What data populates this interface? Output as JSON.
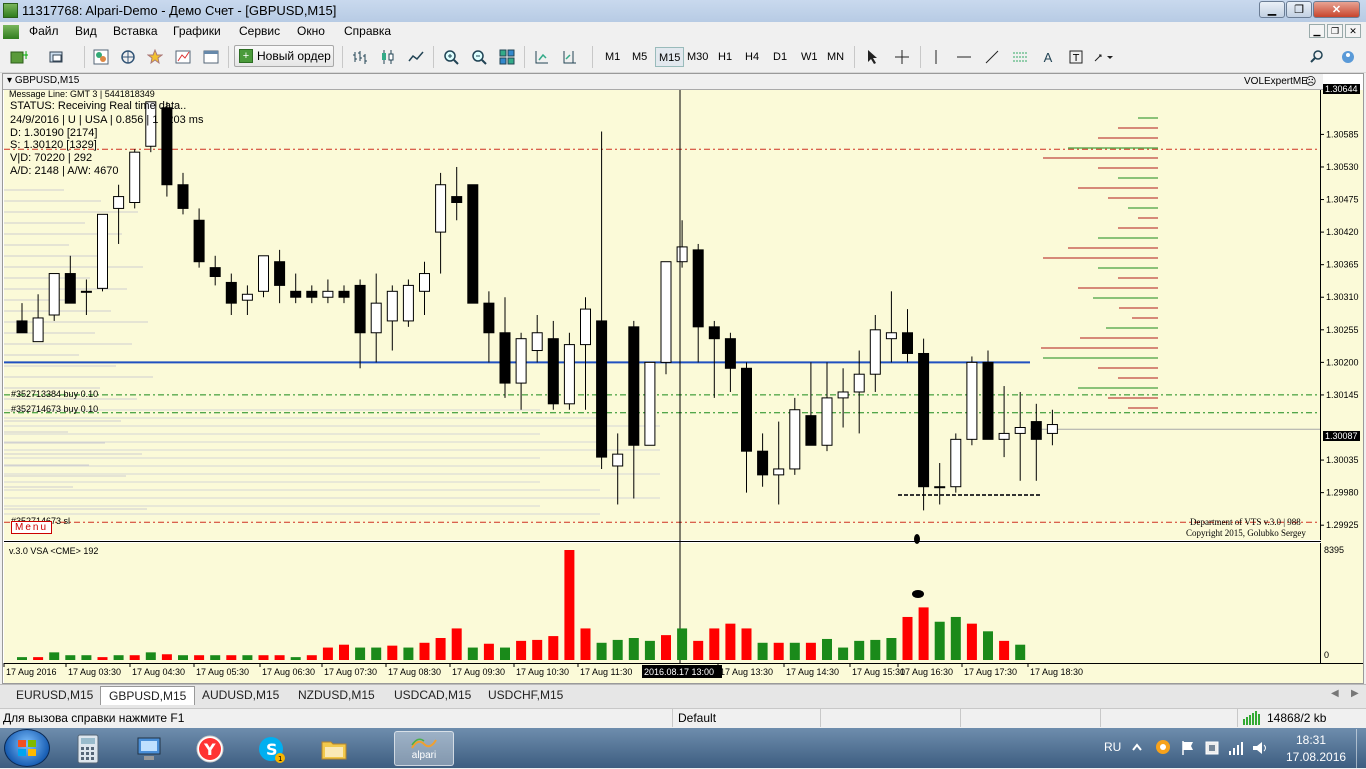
{
  "window": {
    "title": "11317768: Alpari-Demo - Демо Счет - [GBPUSD,M15]",
    "controls": [
      "minimize",
      "restore",
      "close"
    ]
  },
  "menu": {
    "items": [
      "Файл",
      "Вид",
      "Вставка",
      "Графики",
      "Сервис",
      "Окно",
      "Справка"
    ]
  },
  "toolbar": {
    "new_order_label": "Новый ордер",
    "timeframes": [
      "M1",
      "M5",
      "M15",
      "M30",
      "H1",
      "H4",
      "D1",
      "W1",
      "MN"
    ],
    "active_timeframe": "M15"
  },
  "chart": {
    "window_label": "GBPUSD,M15",
    "message_line": "Message Line: GMT 3 | 5441818349",
    "status": "STATUS:  Receiving Real time data..",
    "date_line": "24/9/2016 | U | USA | 0.856 | 1 | 203 ms",
    "d_line": "D: 1.30190  [2174]",
    "s_line": "S: 1.30120  [1329]",
    "vd_line": "V|D: 70220 | 292",
    "ad_line": "A/D: 2148 | A/W: 4670",
    "expert_name": "VOLExpertME",
    "order_1": "#352713384 buy 0.10",
    "order_2": "#352714673 buy 0.10",
    "sl_label": "#352714673 sl",
    "menu_button": "Menu",
    "department": "Department of VTS  v.3.0 | 988",
    "copyright": "Copyright 2015, Golubko Sergey",
    "indicator_label": "v.3.0 VSA <CME> 192",
    "indicator_max": "8395",
    "indicator_min": "0",
    "current_price": "1.30087",
    "top_price": "1.30644",
    "colors": {
      "bull": "#ffffff",
      "bear": "#000000",
      "background": "#fbfad8",
      "volume_up": "#1a8a1a",
      "volume_down": "#ff0000"
    }
  },
  "chart_data": {
    "type": "candlestick",
    "symbol": "GBPUSD",
    "timeframe": "M15",
    "price_ticks": [
      "1.30585",
      "1.30530",
      "1.30475",
      "1.30420",
      "1.30365",
      "1.30310",
      "1.30255",
      "1.30200",
      "1.30145",
      "1.30035",
      "1.29980",
      "1.29925"
    ],
    "time_labels": [
      "17 Aug 2016",
      "17 Aug 03:30",
      "17 Aug 04:30",
      "17 Aug 05:30",
      "17 Aug 06:30",
      "17 Aug 07:30",
      "17 Aug 08:30",
      "17 Aug 09:30",
      "17 Aug 10:30",
      "17 Aug 11:30",
      "2016.08.17 13:00",
      "17 Aug 13:30",
      "17 Aug 14:30",
      "17 Aug 15:30",
      "17 Aug 16:30",
      "17 Aug 17:30",
      "17 Aug 18:30"
    ],
    "crosshair_time": "2016.08.17 13:00",
    "candles": [
      {
        "o": 1.3027,
        "h": 1.303,
        "l": 1.3025,
        "c": 1.3025
      },
      {
        "o": 1.30235,
        "h": 1.30315,
        "l": 1.30235,
        "c": 1.30275
      },
      {
        "o": 1.3028,
        "h": 1.3035,
        "l": 1.3027,
        "c": 1.3035
      },
      {
        "o": 1.3035,
        "h": 1.3038,
        "l": 1.303,
        "c": 1.303
      },
      {
        "o": 1.3032,
        "h": 1.3034,
        "l": 1.3028,
        "c": 1.3032
      },
      {
        "o": 1.30325,
        "h": 1.3045,
        "l": 1.3032,
        "c": 1.3045
      },
      {
        "o": 1.3046,
        "h": 1.305,
        "l": 1.304,
        "c": 1.3048
      },
      {
        "o": 1.3047,
        "h": 1.3056,
        "l": 1.3046,
        "c": 1.30555
      },
      {
        "o": 1.30565,
        "h": 1.3064,
        "l": 1.30555,
        "c": 1.3064
      },
      {
        "o": 1.3063,
        "h": 1.3064,
        "l": 1.3048,
        "c": 1.305
      },
      {
        "o": 1.305,
        "h": 1.3052,
        "l": 1.3045,
        "c": 1.3046
      },
      {
        "o": 1.3044,
        "h": 1.3046,
        "l": 1.3036,
        "c": 1.3037
      },
      {
        "o": 1.3036,
        "h": 1.3038,
        "l": 1.3033,
        "c": 1.30345
      },
      {
        "o": 1.30335,
        "h": 1.3035,
        "l": 1.3028,
        "c": 1.303
      },
      {
        "o": 1.30305,
        "h": 1.3033,
        "l": 1.3028,
        "c": 1.30315
      },
      {
        "o": 1.3032,
        "h": 1.3038,
        "l": 1.3031,
        "c": 1.3038
      },
      {
        "o": 1.3037,
        "h": 1.3039,
        "l": 1.303,
        "c": 1.3033
      },
      {
        "o": 1.3032,
        "h": 1.3035,
        "l": 1.303,
        "c": 1.3031
      },
      {
        "o": 1.3032,
        "h": 1.3033,
        "l": 1.303,
        "c": 1.3031
      },
      {
        "o": 1.3031,
        "h": 1.3034,
        "l": 1.303,
        "c": 1.3032
      },
      {
        "o": 1.3032,
        "h": 1.3033,
        "l": 1.303,
        "c": 1.3031
      },
      {
        "o": 1.3033,
        "h": 1.3034,
        "l": 1.3019,
        "c": 1.3025
      },
      {
        "o": 1.3025,
        "h": 1.3035,
        "l": 1.302,
        "c": 1.303
      },
      {
        "o": 1.3027,
        "h": 1.3033,
        "l": 1.3022,
        "c": 1.3032
      },
      {
        "o": 1.3027,
        "h": 1.3034,
        "l": 1.3026,
        "c": 1.3033
      },
      {
        "o": 1.3032,
        "h": 1.3037,
        "l": 1.3028,
        "c": 1.3035
      },
      {
        "o": 1.3042,
        "h": 1.3052,
        "l": 1.3035,
        "c": 1.305
      },
      {
        "o": 1.3048,
        "h": 1.3053,
        "l": 1.3044,
        "c": 1.3047
      },
      {
        "o": 1.305,
        "h": 1.305,
        "l": 1.303,
        "c": 1.303
      },
      {
        "o": 1.303,
        "h": 1.3032,
        "l": 1.302,
        "c": 1.3025
      },
      {
        "o": 1.3025,
        "h": 1.3031,
        "l": 1.3014,
        "c": 1.30165
      },
      {
        "o": 1.30165,
        "h": 1.3025,
        "l": 1.3012,
        "c": 1.3024
      },
      {
        "o": 1.3022,
        "h": 1.3028,
        "l": 1.302,
        "c": 1.3025
      },
      {
        "o": 1.3024,
        "h": 1.3027,
        "l": 1.3012,
        "c": 1.3013
      },
      {
        "o": 1.3013,
        "h": 1.3025,
        "l": 1.3012,
        "c": 1.3023
      },
      {
        "o": 1.3023,
        "h": 1.3031,
        "l": 1.3012,
        "c": 1.3029
      },
      {
        "o": 1.3027,
        "h": 1.3059,
        "l": 1.3002,
        "c": 1.3004
      },
      {
        "o": 1.30025,
        "h": 1.3008,
        "l": 1.2996,
        "c": 1.30045
      },
      {
        "o": 1.3026,
        "h": 1.3027,
        "l": 1.2997,
        "c": 1.3006
      },
      {
        "o": 1.3006,
        "h": 1.302,
        "l": 1.3006,
        "c": 1.302
      },
      {
        "o": 1.302,
        "h": 1.3037,
        "l": 1.3018,
        "c": 1.3037
      },
      {
        "o": 1.3037,
        "h": 1.3044,
        "l": 1.3036,
        "c": 1.30395
      },
      {
        "o": 1.3039,
        "h": 1.304,
        "l": 1.302,
        "c": 1.3026
      },
      {
        "o": 1.3026,
        "h": 1.3027,
        "l": 1.3014,
        "c": 1.3024
      },
      {
        "o": 1.3024,
        "h": 1.3025,
        "l": 1.3015,
        "c": 1.3019
      },
      {
        "o": 1.3019,
        "h": 1.302,
        "l": 1.2998,
        "c": 1.3005
      },
      {
        "o": 1.3005,
        "h": 1.3008,
        "l": 1.2999,
        "c": 1.3001
      },
      {
        "o": 1.3001,
        "h": 1.301,
        "l": 1.2996,
        "c": 1.3002
      },
      {
        "o": 1.3002,
        "h": 1.3014,
        "l": 1.3001,
        "c": 1.3012
      },
      {
        "o": 1.3011,
        "h": 1.302,
        "l": 1.3008,
        "c": 1.3006
      },
      {
        "o": 1.3006,
        "h": 1.302,
        "l": 1.3005,
        "c": 1.3014
      },
      {
        "o": 1.3014,
        "h": 1.3019,
        "l": 1.3009,
        "c": 1.3015
      },
      {
        "o": 1.3015,
        "h": 1.3022,
        "l": 1.3008,
        "c": 1.3018
      },
      {
        "o": 1.3018,
        "h": 1.3028,
        "l": 1.3015,
        "c": 1.30255
      },
      {
        "o": 1.3024,
        "h": 1.3032,
        "l": 1.302,
        "c": 1.3025
      },
      {
        "o": 1.3025,
        "h": 1.3029,
        "l": 1.302,
        "c": 1.30215
      },
      {
        "o": 1.30215,
        "h": 1.3024,
        "l": 1.2995,
        "c": 1.2999
      },
      {
        "o": 1.2999,
        "h": 1.3003,
        "l": 1.2996,
        "c": 1.2999
      },
      {
        "o": 1.2999,
        "h": 1.3008,
        "l": 1.2998,
        "c": 1.3007
      },
      {
        "o": 1.3007,
        "h": 1.3021,
        "l": 1.3006,
        "c": 1.302
      },
      {
        "o": 1.302,
        "h": 1.3022,
        "l": 1.3007,
        "c": 1.3007
      },
      {
        "o": 1.3007,
        "h": 1.3016,
        "l": 1.3004,
        "c": 1.3008
      },
      {
        "o": 1.3008,
        "h": 1.3015,
        "l": 1.3,
        "c": 1.3009
      },
      {
        "o": 1.301,
        "h": 1.3013,
        "l": 1.3,
        "c": 1.3007
      },
      {
        "o": 1.3008,
        "h": 1.3012,
        "l": 1.3006,
        "c": 1.30095
      }
    ],
    "volumes": [
      3,
      3,
      8,
      5,
      5,
      3,
      5,
      5,
      8,
      6,
      5,
      5,
      5,
      5,
      5,
      5,
      5,
      3,
      5,
      13,
      16,
      13,
      13,
      15,
      13,
      18,
      23,
      33,
      13,
      17,
      13,
      20,
      21,
      25,
      115,
      33,
      18,
      21,
      23,
      20,
      26,
      33,
      20,
      33,
      38,
      33,
      18,
      18,
      18,
      18,
      22,
      13,
      20,
      21,
      23,
      45,
      55,
      40,
      45,
      38,
      30,
      20,
      16,
      0
    ],
    "volume_colors": [
      "g",
      "r",
      "g",
      "g",
      "g",
      "r",
      "g",
      "r",
      "g",
      "r",
      "g",
      "r",
      "g",
      "r",
      "g",
      "r",
      "r",
      "g",
      "r",
      "r",
      "r",
      "g",
      "g",
      "r",
      "g",
      "r",
      "r",
      "r",
      "g",
      "r",
      "g",
      "r",
      "r",
      "r",
      "r",
      "r",
      "g",
      "g",
      "g",
      "g",
      "r",
      "g",
      "r",
      "r",
      "r",
      "r",
      "g",
      "r",
      "g",
      "r",
      "g",
      "g",
      "g",
      "g",
      "g",
      "r",
      "r",
      "g",
      "g",
      "r",
      "g",
      "r",
      "g",
      "g"
    ],
    "price_range": [
      1.299,
      1.3066
    ],
    "horizontal_lines": {
      "blue": 1.302,
      "green_1": 1.30145,
      "green_2": 1.30115,
      "red_top": 1.3056,
      "red_bottom": 1.2993,
      "current": 1.30087
    }
  },
  "tabs": [
    "EURUSD,M15",
    "GBPUSD,M15",
    "AUDUSD,M15",
    "NZDUSD,M15",
    "USDCAD,M15",
    "USDCHF,M15"
  ],
  "active_tab": "GBPUSD,M15",
  "statusbar": {
    "help": "Для вызова справки нажмите F1",
    "profile": "Default",
    "traffic": "14868/2 kb"
  },
  "taskbar": {
    "apps": [
      "calculator",
      "explorer-vm",
      "yandex",
      "skype",
      "file-manager",
      "alpari"
    ],
    "active_app": "alpari",
    "alpari_label": "alpari",
    "lang": "RU",
    "time": "18:31",
    "date": "17.08.2016"
  }
}
